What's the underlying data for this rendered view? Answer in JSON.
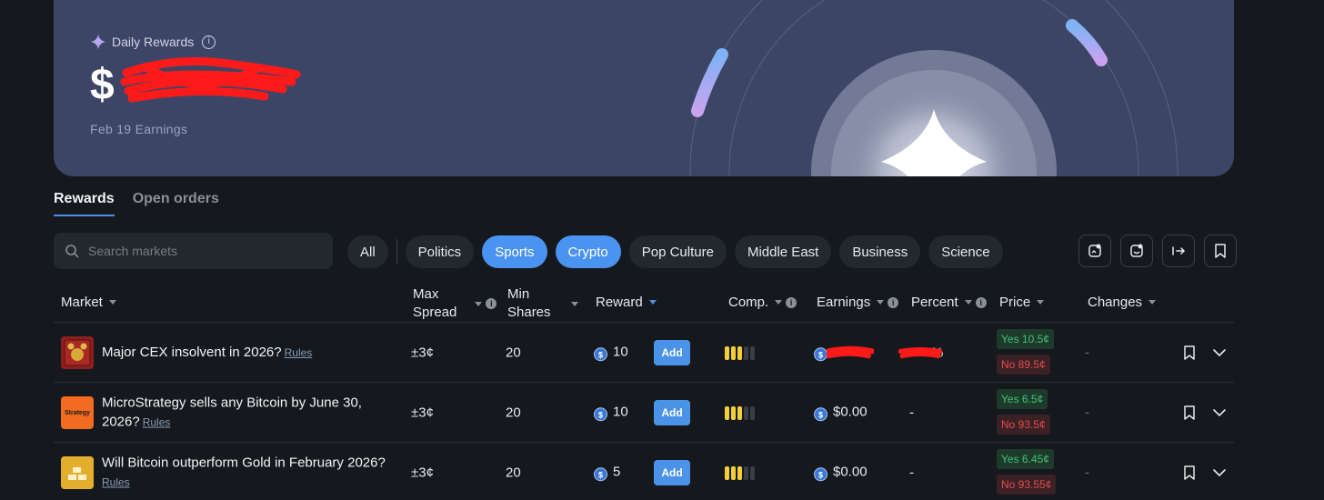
{
  "banner": {
    "title": "Daily Rewards",
    "amount": "$",
    "subtitle": "Feb 19 Earnings"
  },
  "tabs": [
    {
      "label": "Rewards",
      "active": true
    },
    {
      "label": "Open orders",
      "active": false
    }
  ],
  "search": {
    "placeholder": "Search markets"
  },
  "pills": [
    {
      "label": "All",
      "on": false
    },
    {
      "label": "Politics",
      "on": false
    },
    {
      "label": "Sports",
      "on": true
    },
    {
      "label": "Crypto",
      "on": true
    },
    {
      "label": "Pop Culture",
      "on": false
    },
    {
      "label": "Middle East",
      "on": false
    },
    {
      "label": "Business",
      "on": false
    },
    {
      "label": "Science",
      "on": false
    }
  ],
  "columns": {
    "market": "Market",
    "max_spread_1": "Max",
    "max_spread_2": "Spread",
    "min_shares_1": "Min",
    "min_shares_2": "Shares",
    "reward": "Reward",
    "comp": "Comp.",
    "earnings": "Earnings",
    "percent": "Percent",
    "price": "Price",
    "changes": "Changes"
  },
  "add_label": "Add",
  "rows": [
    {
      "title": "Major CEX insolvent in 2026?",
      "rules": "Rules",
      "max_spread": "±3¢",
      "min_shares": "20",
      "reward": "10",
      "comp_level": 3,
      "earnings": "",
      "percent": "%",
      "yes": "Yes 10.5¢",
      "no": "No 89.5¢",
      "changes": "-"
    },
    {
      "title": "MicroStrategy sells any Bitcoin by June 30, 2026?",
      "rules": "Rules",
      "max_spread": "±3¢",
      "min_shares": "20",
      "reward": "10",
      "comp_level": 3,
      "earnings": "$0.00",
      "percent": "-",
      "yes": "Yes 6.5¢",
      "no": "No 93.5¢",
      "changes": "-",
      "logo_text": "Strategy"
    },
    {
      "title": "Will Bitcoin outperform Gold in February 2026?",
      "rules": "Rules",
      "max_spread": "±3¢",
      "min_shares": "20",
      "reward": "5",
      "comp_level": 3,
      "earnings": "$0.00",
      "percent": "-",
      "yes": "Yes 6.45¢",
      "no": "No 93.55¢",
      "changes": "-"
    }
  ],
  "icons": [
    "sparkle-icon",
    "info-icon",
    "search-icon",
    "reward-doc-icon",
    "earnings-doc-icon",
    "share-arrow-icon",
    "bookmark-icon",
    "chevron-down-icon",
    "usdc-coin-icon"
  ]
}
